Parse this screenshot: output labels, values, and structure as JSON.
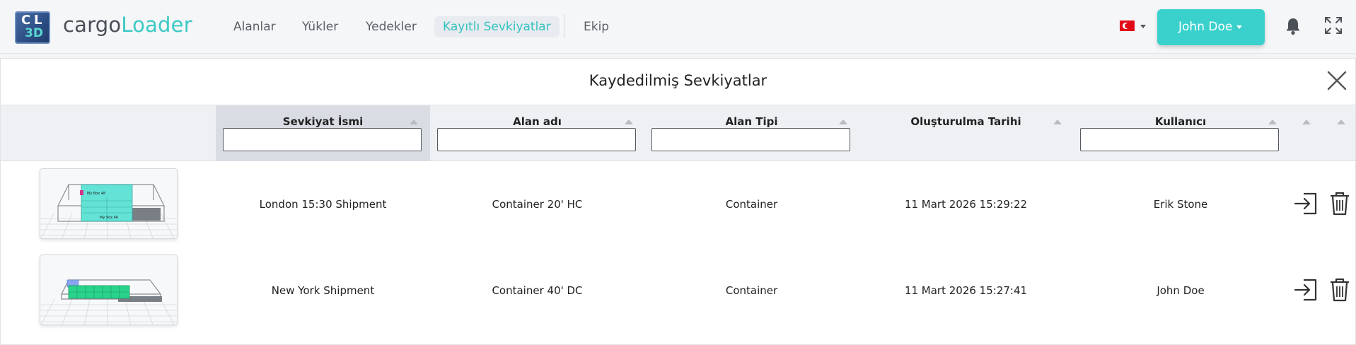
{
  "app": {
    "brand_prefix": "cargo",
    "brand_highlight": "Loader",
    "logo_text_top_left": "C",
    "logo_text_top_right": "L",
    "logo_text_bottom": "3D"
  },
  "nav": {
    "items": [
      {
        "label": "Alanlar"
      },
      {
        "label": "Yükler"
      },
      {
        "label": "Yedekler"
      },
      {
        "label": "Kayıtlı Sevkiyatlar",
        "active": true
      },
      {
        "label": "Ekip"
      }
    ]
  },
  "header_right": {
    "language_flag": "turkey-flag",
    "user_label": "John Doe",
    "bell_icon": "bell-icon",
    "fullscreen_icon": "expand-icon"
  },
  "panel": {
    "title": "Kaydedilmiş Sevkiyatlar",
    "close_icon": "close-icon"
  },
  "table": {
    "columns": [
      {
        "label": "Sevkiyat İsmi",
        "filter_value": "",
        "sorted": true
      },
      {
        "label": "Alan adı",
        "filter_value": ""
      },
      {
        "label": "Alan Tipi",
        "filter_value": ""
      },
      {
        "label": "Oluşturulma Tarihi"
      },
      {
        "label": "Kullanıcı",
        "filter_value": ""
      }
    ],
    "rows": [
      {
        "name": "London 15:30 Shipment",
        "area_name": "Container 20' HC",
        "area_type": "Container",
        "created": "11 Mart 2026 15:29:22",
        "user": "Erik Stone",
        "thumb_labels": [
          "My Box 48",
          "My Box 46"
        ]
      },
      {
        "name": "New York Shipment",
        "area_name": "Container 40' DC",
        "area_type": "Container",
        "created": "11 Mart 2026 15:27:41",
        "user": "John Doe",
        "thumb_labels": []
      }
    ]
  },
  "colors": {
    "accent": "#3ad1cd",
    "brand_teal": "#3cc9c4",
    "sorted_header": "#d9dde3"
  }
}
